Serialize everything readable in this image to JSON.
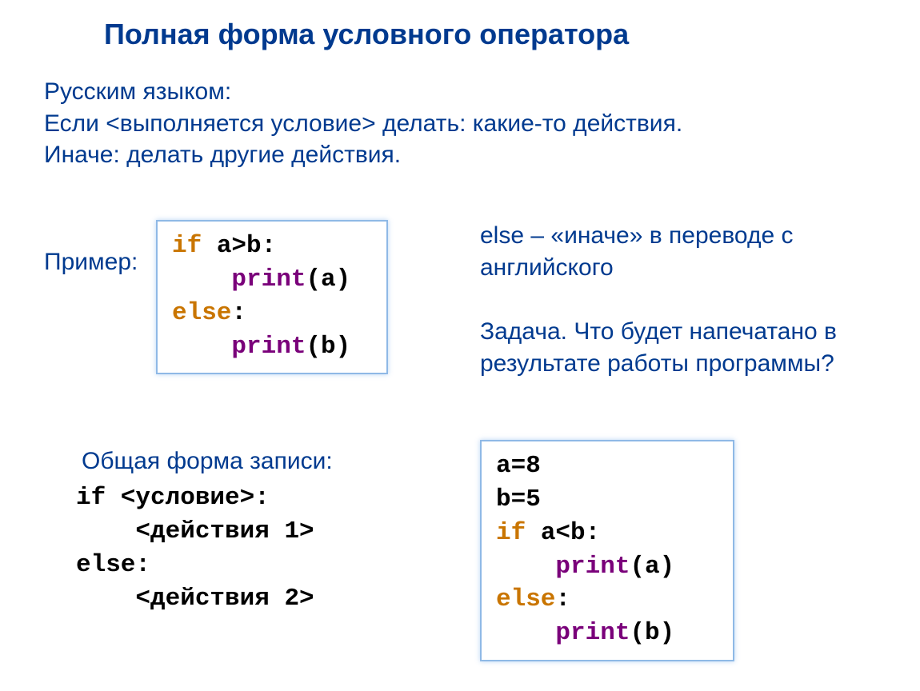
{
  "title": "Полная форма условного оператора",
  "intro_line1": "Русским языком:",
  "intro_line2": "Если <выполняется условие> делать: какие-то действия.",
  "intro_line3": "Иначе: делать другие действия.",
  "example_label": "Пример:",
  "example_code": {
    "l1_kw": "if",
    "l1_rest": " a>b",
    "l1_colon": ":",
    "l2_fn": "print",
    "l2_arg": "(a)",
    "l3_kw": "else",
    "l3_colon": ":",
    "l4_fn": "print",
    "l4_arg": "(b)"
  },
  "else_note": "else – «иначе» в переводе с английского",
  "task_note": "Задача. Что будет напечатано в результате работы программы?",
  "general_title": "Общая форма записи:",
  "general_code": {
    "l1": "if <условие>:",
    "l2": "    <действия 1>",
    "l3": "else:",
    "l4": "    <действия 2>"
  },
  "task_code": {
    "l1": "a=8",
    "l2": "b=5",
    "l3_kw": "if",
    "l3_rest": " a<b",
    "l3_colon": ":",
    "l4_fn": "print",
    "l4_arg": "(a)",
    "l5_kw": "else",
    "l5_colon": ":",
    "l6_fn": "print",
    "l6_arg": "(b)"
  }
}
